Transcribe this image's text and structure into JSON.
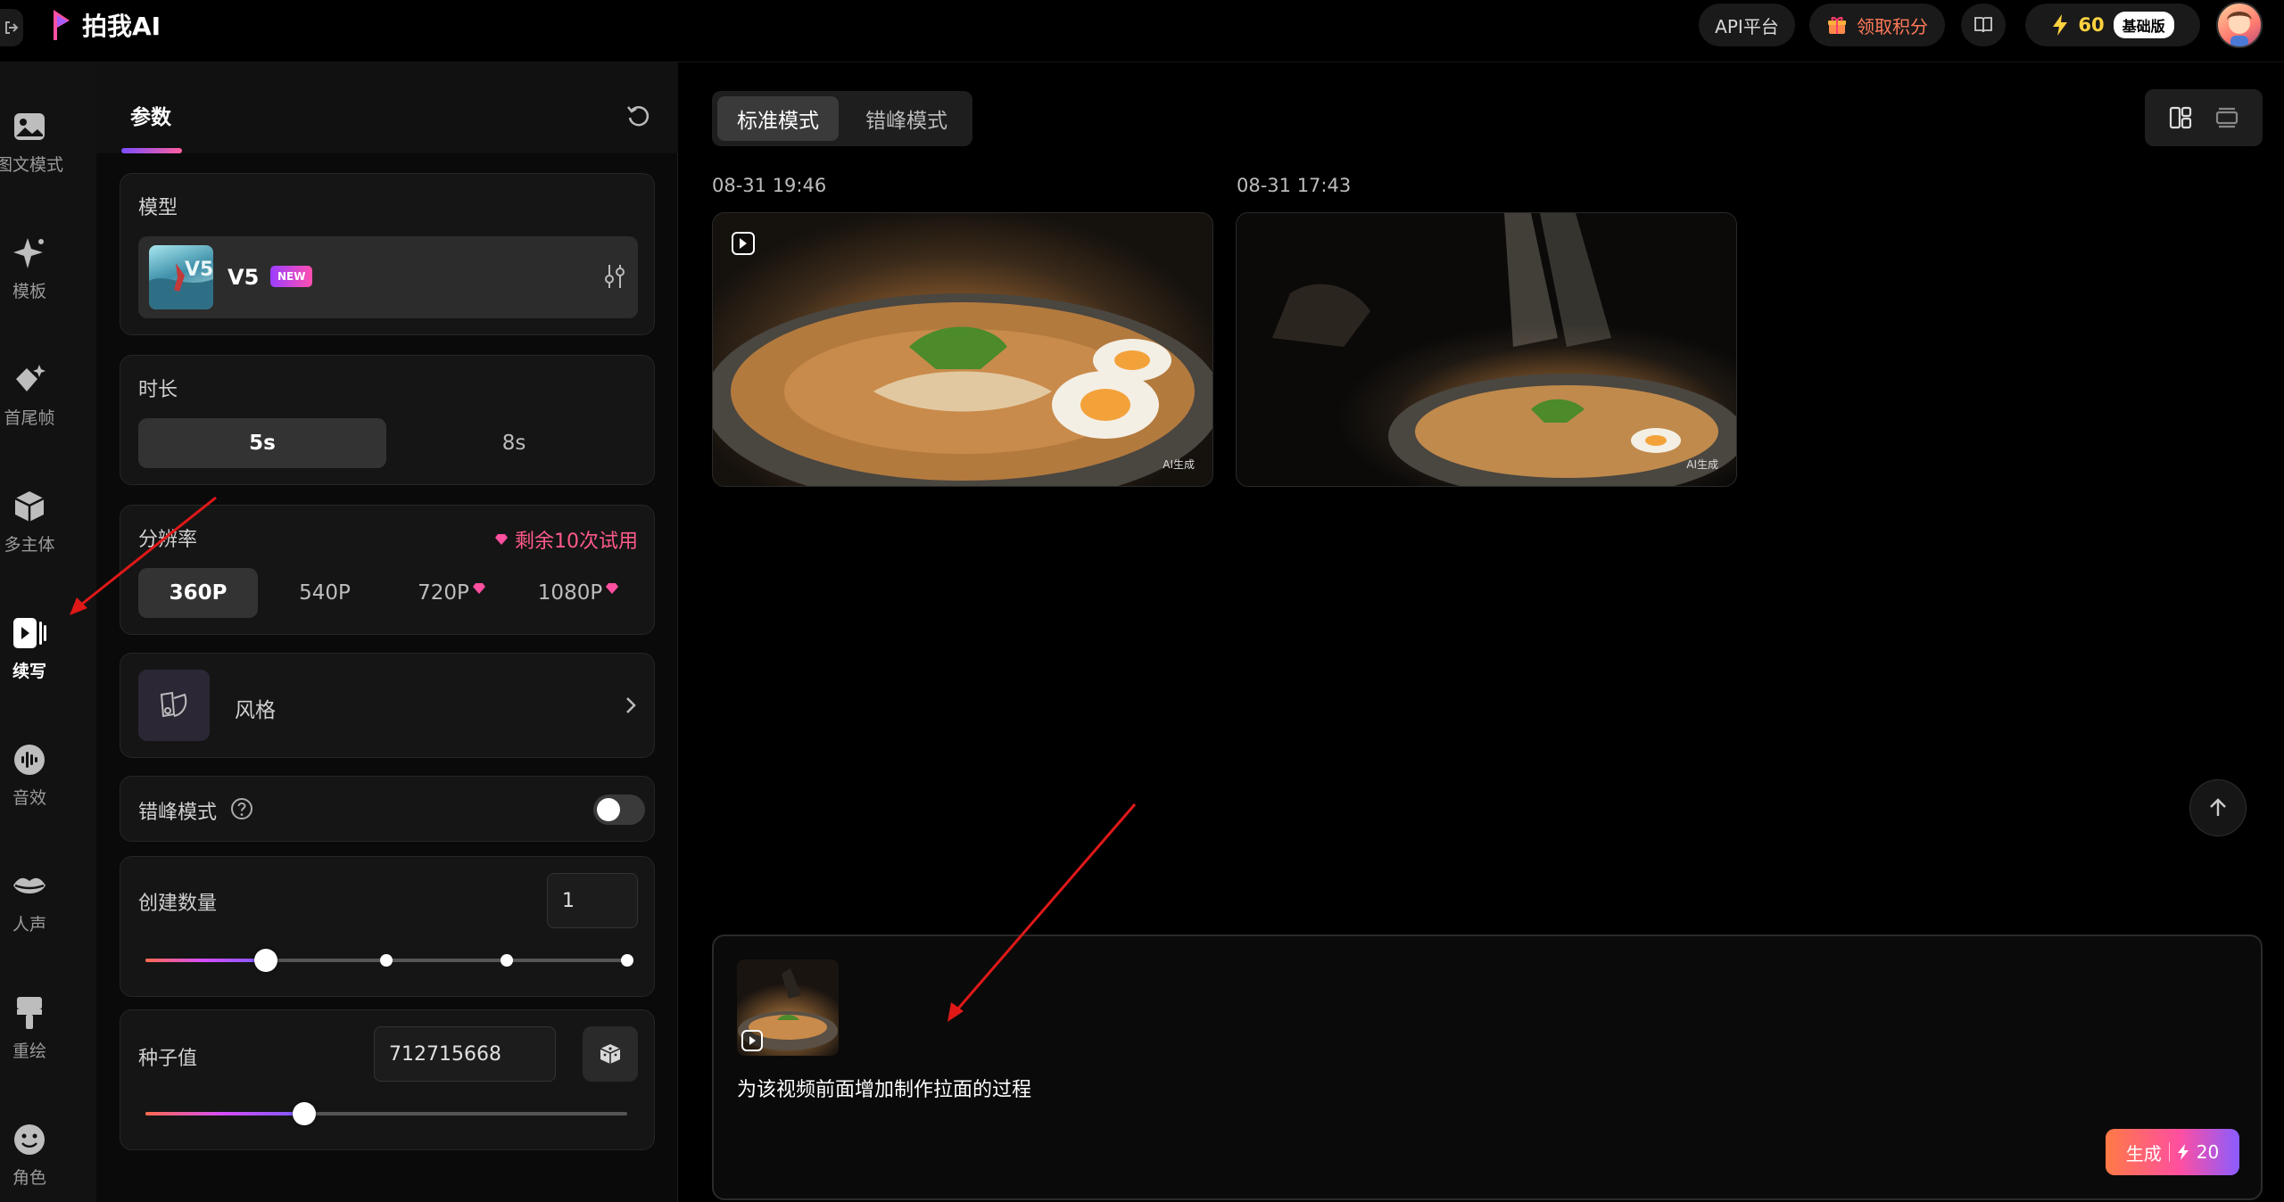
{
  "app": {
    "title": "拍我AI",
    "accent": "#ff4fa0"
  },
  "topbar": {
    "api_label": "API平台",
    "points_label": "领取积分",
    "credits": "60",
    "plan_badge": "基础版",
    "icons": [
      "back-icon",
      "gift-icon",
      "book-icon",
      "lightning-icon",
      "avatar"
    ]
  },
  "rail": {
    "items": [
      {
        "label": "图文模式",
        "icon": "image-icon"
      },
      {
        "label": "模板",
        "icon": "sparkle-icon"
      },
      {
        "label": "首尾帧",
        "icon": "diamond-sparkle-icon"
      },
      {
        "label": "多主体",
        "icon": "cube-icon"
      },
      {
        "label": "续写",
        "icon": "video-extend-icon",
        "active": true
      },
      {
        "label": "音效",
        "icon": "sound-wave-icon"
      },
      {
        "label": "人声",
        "icon": "lips-icon"
      },
      {
        "label": "重绘",
        "icon": "brush-icon"
      },
      {
        "label": "角色",
        "icon": "smile-icon"
      }
    ]
  },
  "panel": {
    "title": "参数",
    "model": {
      "label": "模型",
      "name": "V5",
      "badge": "NEW"
    },
    "duration": {
      "label": "时长",
      "options": [
        "5s",
        "8s"
      ],
      "selected": "5s"
    },
    "resolution": {
      "label": "分辨率",
      "trial_text": "剩余10次试用",
      "options": [
        "360P",
        "540P",
        "720P",
        "1080P"
      ],
      "selected": "360P"
    },
    "style": {
      "label": "风格"
    },
    "peak_mode": {
      "label": "错峰模式",
      "enabled": false
    },
    "count": {
      "label": "创建数量",
      "value": "1",
      "slider_fraction": 0.25
    },
    "seed": {
      "label": "种子值",
      "value": "712715668",
      "slider_fraction": 0.33
    }
  },
  "main": {
    "mode_tabs": [
      "标准模式",
      "错峰模式"
    ],
    "selected_mode": "标准模式",
    "videos": [
      {
        "timestamp": "08-31 19:46",
        "tag": "AI生成"
      },
      {
        "timestamp": "08-31 17:43",
        "tag": "AI生成"
      }
    ],
    "prompt": {
      "text": "为该视频前面增加制作拉面的过程",
      "generate_label": "生成",
      "generate_cost": "20"
    }
  }
}
